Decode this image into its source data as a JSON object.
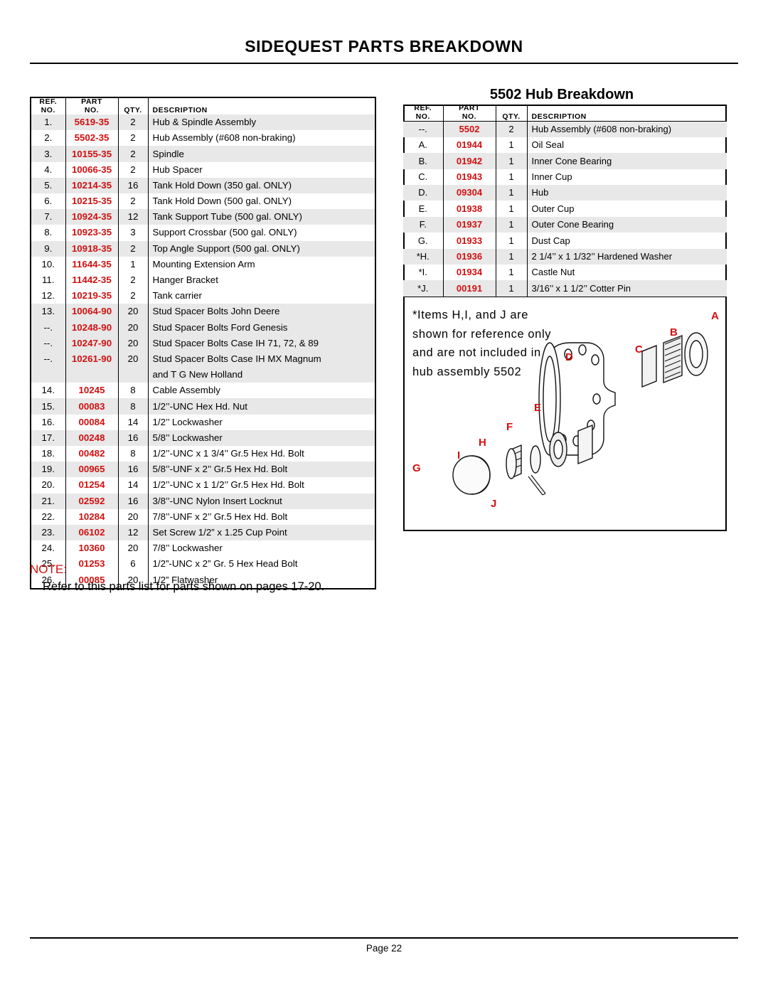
{
  "document": {
    "title": "SIDEQUEST PARTS BREAKDOWN",
    "footer": "Page 22"
  },
  "main_table": {
    "headers": {
      "ref_line1": "REF.",
      "ref_line2": "NO.",
      "part_line1": "PART",
      "part_line2": "NO.",
      "qty": "QTY.",
      "description": "DESCRIPTION"
    },
    "rows": [
      {
        "ref": "1.",
        "part": "5619-35",
        "qty": "2",
        "desc": "Hub & Spindle Assembly",
        "shade": true
      },
      {
        "ref": "2.",
        "part": "5502-35",
        "qty": "2",
        "desc": "Hub Assembly (#608 non-braking)",
        "shade": false
      },
      {
        "ref": "3.",
        "part": "10155-35",
        "qty": "2",
        "desc": "Spindle",
        "shade": true
      },
      {
        "ref": "4.",
        "part": "10066-35",
        "qty": "2",
        "desc": "Hub Spacer",
        "shade": false
      },
      {
        "ref": "5.",
        "part": "10214-35",
        "qty": "16",
        "desc": "Tank Hold Down (350 gal. ONLY)",
        "shade": true
      },
      {
        "ref": "6.",
        "part": "10215-35",
        "qty": "2",
        "desc": "Tank Hold Down (500 gal. ONLY)",
        "shade": false
      },
      {
        "ref": "7.",
        "part": "10924-35",
        "qty": "12",
        "desc": "Tank Support Tube (500 gal. ONLY)",
        "shade": true
      },
      {
        "ref": "8.",
        "part": "10923-35",
        "qty": "3",
        "desc": "Support Crossbar (500 gal. ONLY)",
        "shade": false
      },
      {
        "ref": "9.",
        "part": "10918-35",
        "qty": "2",
        "desc": "Top Angle Support (500 gal. ONLY)",
        "shade": true
      },
      {
        "ref": "10.",
        "part": "11644-35",
        "qty": "1",
        "desc": "Mounting Extension Arm",
        "shade": false
      },
      {
        "ref": "11.",
        "part": "11442-35",
        "qty": "2",
        "desc": "Hanger Bracket",
        "shade": false
      },
      {
        "ref": "12.",
        "part": "10219-35",
        "qty": "2",
        "desc": "Tank carrier",
        "shade": false
      },
      {
        "ref": "13.",
        "part": "10064-90",
        "qty": "20",
        "desc": "Stud Spacer Bolts John Deere",
        "shade": true
      },
      {
        "ref": "--.",
        "part": "10248-90",
        "qty": "20",
        "desc": "Stud Spacer Bolts Ford Genesis",
        "shade": true
      },
      {
        "ref": "--.",
        "part": "10247-90",
        "qty": "20",
        "desc": "Stud Spacer Bolts Case IH 71, 72, & 89",
        "shade": true
      },
      {
        "ref": "--.",
        "part": "10261-90",
        "qty": "20",
        "desc": "Stud Spacer Bolts Case IH MX Magnum",
        "shade": true
      },
      {
        "ref": "",
        "part": "",
        "qty": "",
        "desc": "and T G New Holland",
        "shade": true
      },
      {
        "ref": "14.",
        "part": "10245",
        "qty": "8",
        "desc": "Cable Assembly",
        "shade": false
      },
      {
        "ref": "15.",
        "part": "00083",
        "qty": "8",
        "desc": "1/2’’-UNC Hex Hd. Nut",
        "shade": true
      },
      {
        "ref": "16.",
        "part": "00084",
        "qty": "14",
        "desc": "1/2’’ Lockwasher",
        "shade": false
      },
      {
        "ref": "17.",
        "part": "00248",
        "qty": "16",
        "desc": "5/8’’ Lockwasher",
        "shade": true
      },
      {
        "ref": "18.",
        "part": "00482",
        "qty": "8",
        "desc": "1/2’’-UNC x 1 3/4’’ Gr.5 Hex Hd. Bolt",
        "shade": false
      },
      {
        "ref": "19.",
        "part": "00965",
        "qty": "16",
        "desc": "5/8’’-UNF x 2’’ Gr.5 Hex Hd. Bolt",
        "shade": true
      },
      {
        "ref": "20.",
        "part": "01254",
        "qty": "14",
        "desc": "1/2’’-UNC x 1 1/2’’ Gr.5 Hex Hd. Bolt",
        "shade": false
      },
      {
        "ref": "21.",
        "part": "02592",
        "qty": "16",
        "desc": "3/8’’-UNC Nylon Insert Locknut",
        "shade": true
      },
      {
        "ref": "22.",
        "part": "10284",
        "qty": "20",
        "desc": "7/8’’-UNF x 2’’ Gr.5 Hex Hd. Bolt",
        "shade": false
      },
      {
        "ref": "23.",
        "part": "06102",
        "qty": "12",
        "desc": "Set Screw 1/2” x 1.25 Cup Point",
        "shade": true
      },
      {
        "ref": "24.",
        "part": "10360",
        "qty": "20",
        "desc": "7/8’’ Lockwasher",
        "shade": false
      },
      {
        "ref": "25.",
        "part": "01253",
        "qty": "6",
        "desc": "1/2”-UNC x 2” Gr. 5 Hex Head Bolt",
        "shade": false
      },
      {
        "ref": "26.",
        "part": "00085",
        "qty": "20",
        "desc": "1/2” Flatwasher",
        "shade": false
      }
    ]
  },
  "note": {
    "label": "NOTE:",
    "text": "Refer to this parts list for parts shown on pages 17-20."
  },
  "hub_panel": {
    "title": "5502 Hub Breakdown",
    "headers": {
      "ref_line1": "REF.",
      "ref_line2": "NO.",
      "part_line1": "PART",
      "part_line2": "NO.",
      "qty": "QTY.",
      "description": "DESCRIPTION"
    },
    "rows": [
      {
        "ref": "--.",
        "part": "5502",
        "qty": "2",
        "desc": "Hub Assembly (#608 non-braking)",
        "shade": true
      },
      {
        "ref": "A.",
        "part": "01944",
        "qty": "1",
        "desc": "Oil Seal",
        "shade": false
      },
      {
        "ref": "B.",
        "part": "01942",
        "qty": "1",
        "desc": "Inner Cone Bearing",
        "shade": true
      },
      {
        "ref": "C.",
        "part": "01943",
        "qty": "1",
        "desc": "Inner Cup",
        "shade": false
      },
      {
        "ref": "D.",
        "part": "09304",
        "qty": "1",
        "desc": "Hub",
        "shade": true
      },
      {
        "ref": "E.",
        "part": "01938",
        "qty": "1",
        "desc": "Outer Cup",
        "shade": false
      },
      {
        "ref": "F.",
        "part": "01937",
        "qty": "1",
        "desc": "Outer Cone Bearing",
        "shade": true
      },
      {
        "ref": "G.",
        "part": "01933",
        "qty": "1",
        "desc": "Dust Cap",
        "shade": false
      },
      {
        "ref": "*H.",
        "part": "01936",
        "qty": "1",
        "desc": "2 1/4’’ x 1 1/32’’ Hardened Washer",
        "shade": true
      },
      {
        "ref": "*I.",
        "part": "01934",
        "qty": "1",
        "desc": "Castle Nut",
        "shade": false
      },
      {
        "ref": "*J.",
        "part": "00191",
        "qty": "1",
        "desc": "3/16’’ x 1 1/2’’ Cotter Pin",
        "shade": true
      }
    ],
    "footnote_lines": [
      "*Items H,I, and J are",
      "shown for reference only",
      "and are not included in",
      "hub assembly 5502"
    ],
    "diagram_labels": {
      "a": "A",
      "b": "B",
      "c": "C",
      "d": "D",
      "e": "E",
      "f": "F",
      "g": "G",
      "h": "H",
      "i": "I",
      "j": "J"
    }
  },
  "colors": {
    "accent_red": "#d01010",
    "shade_gray": "#e8e8e8",
    "line_black": "#000000"
  }
}
